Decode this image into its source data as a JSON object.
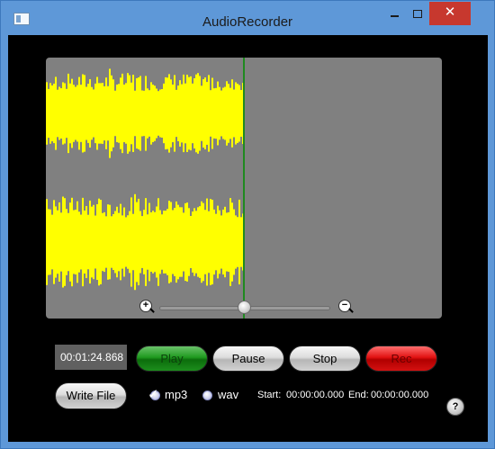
{
  "window": {
    "title": "AudioRecorder",
    "close_glyph": "✕"
  },
  "waveform": {
    "played_fraction": 0.5,
    "wave_color": "#ffff00",
    "background_color": "#808080",
    "cursor_color": "#1f8a1f",
    "zoom_in_glyph": "+",
    "zoom_out_glyph": "−",
    "zoom_slider_level": 0.5
  },
  "transport": {
    "time": "00:01:24.868",
    "play_label": "Play",
    "pause_label": "Pause",
    "stop_label": "Stop",
    "rec_label": "Rec",
    "write_file_label": "Write File"
  },
  "format": {
    "options": [
      {
        "label": "mp3",
        "selected": true
      },
      {
        "label": "wav",
        "selected": false
      }
    ],
    "check_glyph": "✓"
  },
  "selection": {
    "start_label": "Start:",
    "start_value": "00:00:00.000",
    "end_label": "End:",
    "end_value": "00:00:00.000"
  },
  "help": {
    "glyph": "?"
  }
}
